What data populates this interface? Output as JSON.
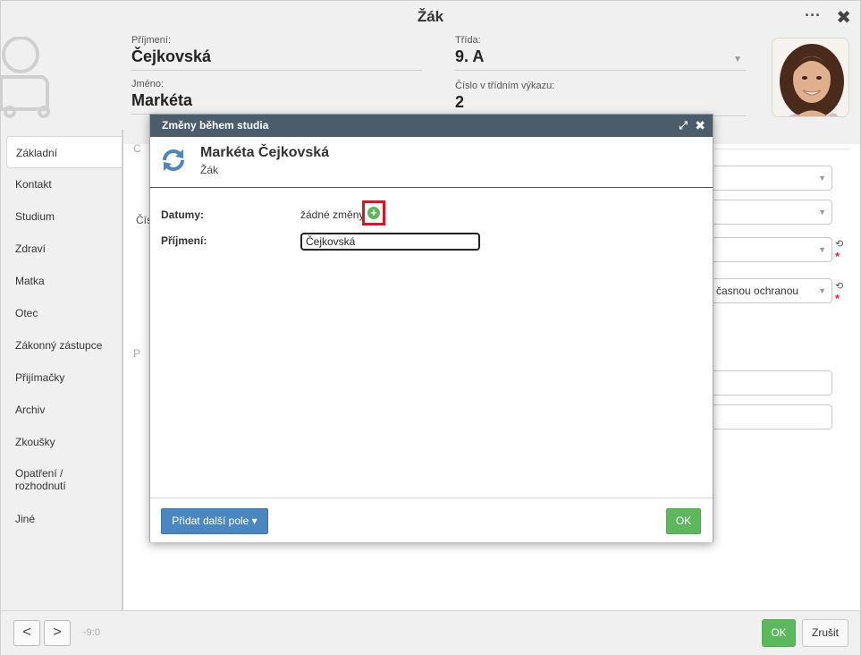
{
  "window": {
    "title": "Žák",
    "more_label": "···",
    "close_label": "✖"
  },
  "header": {
    "surname_label": "Příjmení:",
    "surname_value": "Čejkovská",
    "firstname_label": "Jméno:",
    "firstname_value": "Markéta",
    "class_label": "Třída:",
    "class_value": "9. A",
    "register_label": "Číslo v třídním výkazu:",
    "register_value": "2"
  },
  "sidebar": {
    "items": [
      {
        "label": "Základní"
      },
      {
        "label": "Kontakt"
      },
      {
        "label": "Studium"
      },
      {
        "label": "Zdraví"
      },
      {
        "label": "Matka"
      },
      {
        "label": "Otec"
      },
      {
        "label": "Zákonný zástupce"
      },
      {
        "label": "Přijímačky"
      },
      {
        "label": "Archiv"
      },
      {
        "label": "Zkoušky"
      },
      {
        "label": "Opatření / rozhodnutí"
      },
      {
        "label": "Jiné"
      }
    ]
  },
  "background_form": {
    "frag_c": "C",
    "frag_cis": "Čís",
    "frag_p": "P",
    "dropdown4_value": "časnou ochranou"
  },
  "bottom": {
    "prev_label": "<",
    "next_label": ">",
    "record_info": "-9:0",
    "ok_label": "OK",
    "cancel_label": "Zrušit"
  },
  "modal": {
    "title": "Změny během studia",
    "person_name": "Markéta Čejkovská",
    "person_role": "Žák",
    "dates_label": "Datumy:",
    "dates_value": "žádné změny",
    "surname_label": "Příjmení:",
    "surname_input_value": "Čejkovská",
    "add_field_label": "Přidat další pole ▾",
    "ok_label": "OK"
  }
}
